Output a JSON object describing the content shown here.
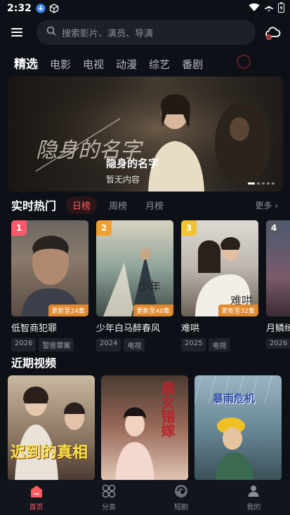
{
  "status": {
    "time": "2:32"
  },
  "search": {
    "placeholder": "搜索影片、演员、导演"
  },
  "tabs": [
    {
      "label": "精选",
      "active": true
    },
    {
      "label": "电影"
    },
    {
      "label": "电视"
    },
    {
      "label": "动漫"
    },
    {
      "label": "综艺"
    },
    {
      "label": "番剧"
    }
  ],
  "banner": {
    "title": "隐身的名字",
    "subtitle": "暂无内容"
  },
  "hot": {
    "title": "实时热门",
    "ranks": [
      "日榜",
      "周榜",
      "月榜"
    ],
    "more": "更多",
    "items": [
      {
        "rank": "1",
        "name": "低智商犯罪",
        "update": "更新至24集",
        "year": "2026",
        "tag": "警匪罪案",
        "badge_color": "#ff5a6a"
      },
      {
        "rank": "2",
        "name": "少年白马醉春风",
        "update": "更新至40集",
        "year": "2024",
        "tag": "电视",
        "badge_color": "#f0a030"
      },
      {
        "rank": "3",
        "name": "难哄",
        "update": "更新至32集",
        "year": "2025",
        "tag": "电视",
        "badge_color": "#f2c230"
      },
      {
        "rank": "4",
        "name": "月鳞绮纪",
        "update": "",
        "year": "2026",
        "tag": "",
        "badge_color": "#555a66"
      }
    ]
  },
  "recent": {
    "title": "近期视频",
    "items": [
      {
        "overlay": "迟到的真相"
      },
      {
        "overlay": "盾女错嫁"
      },
      {
        "overlay": "暴雨危机"
      }
    ]
  },
  "nav": [
    {
      "label": "首页",
      "icon": "home-icon",
      "active": true
    },
    {
      "label": "分类",
      "icon": "category-icon"
    },
    {
      "label": "短剧",
      "icon": "short-drama-icon"
    },
    {
      "label": "我的",
      "icon": "profile-icon"
    }
  ],
  "colors": {
    "accent": "#ff5a5f",
    "background": "#0d1117"
  }
}
